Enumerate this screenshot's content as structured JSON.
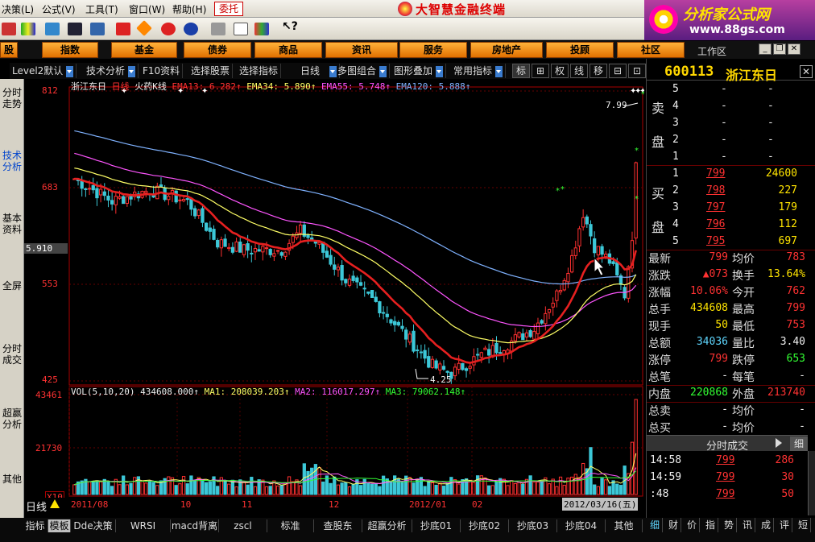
{
  "menu": {
    "items": [
      "决策(L)",
      "公式(V)",
      "工具(T)",
      "窗口(W)",
      "帮助(H)"
    ],
    "entrust": "委托",
    "app_title": "大智慧金融终端"
  },
  "logo": {
    "text": "分析家公式网",
    "url": "www.88gs.com"
  },
  "categories": [
    "股",
    "指数",
    "基金",
    "债券",
    "商品",
    "资讯",
    "服务",
    "房地产",
    "投顾",
    "社区"
  ],
  "workspace_label": "工作区",
  "funcbar": {
    "level2": "Level2默认",
    "tech": "技术分析",
    "f10": "F10资料",
    "select_stock": "选择股票",
    "select_indicator": "选择指标",
    "period": "日线",
    "multi": "多图组合",
    "overlay": "图形叠加",
    "common_ind": "常用指标",
    "buttons": [
      "标",
      "⊞",
      "权",
      "线",
      "移",
      "⊟",
      "⊡"
    ]
  },
  "left_tabs": [
    "分时走势",
    "技术分析",
    "基本资料",
    "全屏",
    "分时成交",
    "超赢分析",
    "其他"
  ],
  "chart": {
    "header_name": "浙江东日",
    "header_period": "日线",
    "header_indicator": "火药K线",
    "ema": [
      {
        "label": "EMA13: 6.282↑",
        "color": "#ff3333"
      },
      {
        "label": "EMA34: 5.890↑",
        "color": "#ffff66"
      },
      {
        "label": "EMA55: 5.748↑",
        "color": "#ff55ff"
      },
      {
        "label": "EMA120: 5.888↑",
        "color": "#7fb2ff"
      }
    ],
    "price_ticks": [
      "812",
      "683",
      "553",
      "425"
    ],
    "crosshair_value": "5.910",
    "high_label": "7.99",
    "low_label": "4.25",
    "vol_header": "VOL(5,10,20) 434608.000↑",
    "vol_ma": [
      {
        "label": "MA1: 208039.203↑",
        "color": "#ffff66"
      },
      {
        "label": "MA2: 116017.297↑",
        "color": "#ff55ff"
      },
      {
        "label": "MA3: 79062.148↑",
        "color": "#33ff33"
      }
    ],
    "vol_ticks": [
      "43461",
      "21730"
    ],
    "vol_unit": "X10",
    "date_labels": [
      "2011/08",
      "10",
      "11",
      "12",
      "2012/01",
      "02"
    ],
    "cursor_date": "2012/03/16(五)",
    "period_label": "日线"
  },
  "chart_data": {
    "type": "candlestick",
    "title": "浙江东日 日线",
    "ylim": [
      4.25,
      8.12
    ],
    "xlabels": [
      "2011/08",
      "10",
      "11",
      "12",
      "2012/01",
      "02",
      "2012/03/16"
    ],
    "price_high": 7.99,
    "price_low": 4.25,
    "series": [
      {
        "name": "EMA13",
        "last": 6.282
      },
      {
        "name": "EMA34",
        "last": 5.89
      },
      {
        "name": "EMA55",
        "last": 5.748
      },
      {
        "name": "EMA120",
        "last": 5.888
      }
    ],
    "volume": {
      "last": 434608.0,
      "ma1": 208039.203,
      "ma2": 116017.297,
      "ma3": 79062.148,
      "axis_max": 43461,
      "axis_mid": 21730,
      "unit": "X10"
    }
  },
  "bottom_tabs": [
    "指标",
    "模板",
    "Dde决策",
    "WRSI",
    "macd背离",
    "zscl",
    "标准",
    "查股东",
    "超赢分析",
    "抄底01",
    "抄底02",
    "抄底03",
    "抄底04",
    "其他"
  ],
  "quote": {
    "code": "600113",
    "name": "浙江东日",
    "sell_label": [
      "卖",
      "盘"
    ],
    "buy_label": [
      "买",
      "盘"
    ],
    "sell": [
      {
        "level": "5",
        "price": "-",
        "vol": "-"
      },
      {
        "level": "4",
        "price": "-",
        "vol": "-"
      },
      {
        "level": "3",
        "price": "-",
        "vol": "-"
      },
      {
        "level": "2",
        "price": "-",
        "vol": "-"
      },
      {
        "level": "1",
        "price": "-",
        "vol": "-"
      }
    ],
    "buy": [
      {
        "level": "1",
        "price": "799",
        "vol": "24600"
      },
      {
        "level": "2",
        "price": "798",
        "vol": "227"
      },
      {
        "level": "3",
        "price": "797",
        "vol": "179"
      },
      {
        "level": "4",
        "price": "796",
        "vol": "112"
      },
      {
        "level": "5",
        "price": "795",
        "vol": "697"
      }
    ],
    "stats": [
      {
        "l1": "最新",
        "v1": "799",
        "c1": "red",
        "l2": "均价",
        "v2": "783",
        "c2": "red"
      },
      {
        "l1": "涨跌",
        "v1": "▲073",
        "c1": "red",
        "l2": "换手",
        "v2": "13.64%",
        "c2": "yellow"
      },
      {
        "l1": "涨幅",
        "v1": "10.06%",
        "c1": "red",
        "l2": "今开",
        "v2": "762",
        "c2": "red"
      },
      {
        "l1": "总手",
        "v1": "434608",
        "c1": "yellow",
        "l2": "最高",
        "v2": "799",
        "c2": "red"
      },
      {
        "l1": "现手",
        "v1": "50",
        "c1": "yellow",
        "l2": "最低",
        "v2": "753",
        "c2": "red"
      },
      {
        "l1": "总额",
        "v1": "34036",
        "c1": "cyan",
        "l2": "量比",
        "v2": "3.40",
        "c2": "white"
      },
      {
        "l1": "涨停",
        "v1": "799",
        "c1": "red",
        "l2": "跌停",
        "v2": "653",
        "c2": "green"
      },
      {
        "l1": "总笔",
        "v1": "-",
        "c1": "white",
        "l2": "每笔",
        "v2": "-",
        "c2": "white"
      },
      {
        "l1": "内盘",
        "v1": "220868",
        "c1": "green",
        "l2": "外盘",
        "v2": "213740",
        "c2": "red"
      },
      {
        "l1": "总卖",
        "v1": "-",
        "c1": "white",
        "l2": "均价",
        "v2": "-",
        "c2": "white"
      },
      {
        "l1": "总买",
        "v1": "-",
        "c1": "white",
        "l2": "均价",
        "v2": "-",
        "c2": "white"
      }
    ],
    "tick_header": "分时成交",
    "tick_btn": "细",
    "ticks": [
      {
        "time": "14:58",
        "price": "799",
        "vol": "286",
        "vc": "red"
      },
      {
        "time": "14:59",
        "price": "799",
        "vol": "30",
        "vc": "red"
      },
      {
        "time": ":48",
        "price": "799",
        "vol": "50",
        "vc": "red"
      }
    ],
    "bottom_tabs": [
      "细",
      "财",
      "价",
      "指",
      "势",
      "讯",
      "成",
      "评",
      "短"
    ]
  }
}
